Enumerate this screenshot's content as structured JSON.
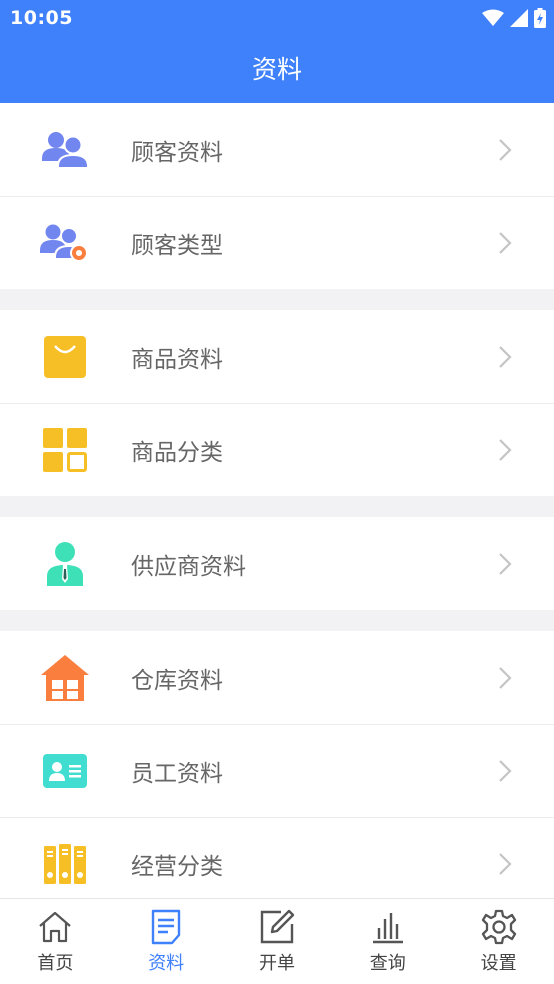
{
  "status_bar": {
    "time": "10:05"
  },
  "header": {
    "title": "资料"
  },
  "sections": [
    {
      "items": [
        {
          "label": "顾客资料",
          "icon": "customers-icon"
        },
        {
          "label": "顾客类型",
          "icon": "customer-type-icon"
        }
      ]
    },
    {
      "items": [
        {
          "label": "商品资料",
          "icon": "shopping-bag-icon"
        },
        {
          "label": "商品分类",
          "icon": "grid-category-icon"
        }
      ]
    },
    {
      "items": [
        {
          "label": "供应商资料",
          "icon": "supplier-icon"
        }
      ]
    },
    {
      "items": [
        {
          "label": "仓库资料",
          "icon": "warehouse-icon"
        },
        {
          "label": "员工资料",
          "icon": "id-card-icon"
        },
        {
          "label": "经营分类",
          "icon": "binders-icon"
        }
      ]
    }
  ],
  "bottom_nav": [
    {
      "label": "首页",
      "icon": "home-icon"
    },
    {
      "label": "资料",
      "icon": "document-icon",
      "active": true
    },
    {
      "label": "开单",
      "icon": "edit-icon"
    },
    {
      "label": "查询",
      "icon": "bar-chart-icon"
    },
    {
      "label": "设置",
      "icon": "gear-icon"
    }
  ],
  "colors": {
    "primary": "#3f80fb",
    "people": "#7286f0",
    "yellow": "#f7bf26",
    "green": "#3ee0b8",
    "orange": "#fa7f3e",
    "teal": "#40ddd0"
  }
}
